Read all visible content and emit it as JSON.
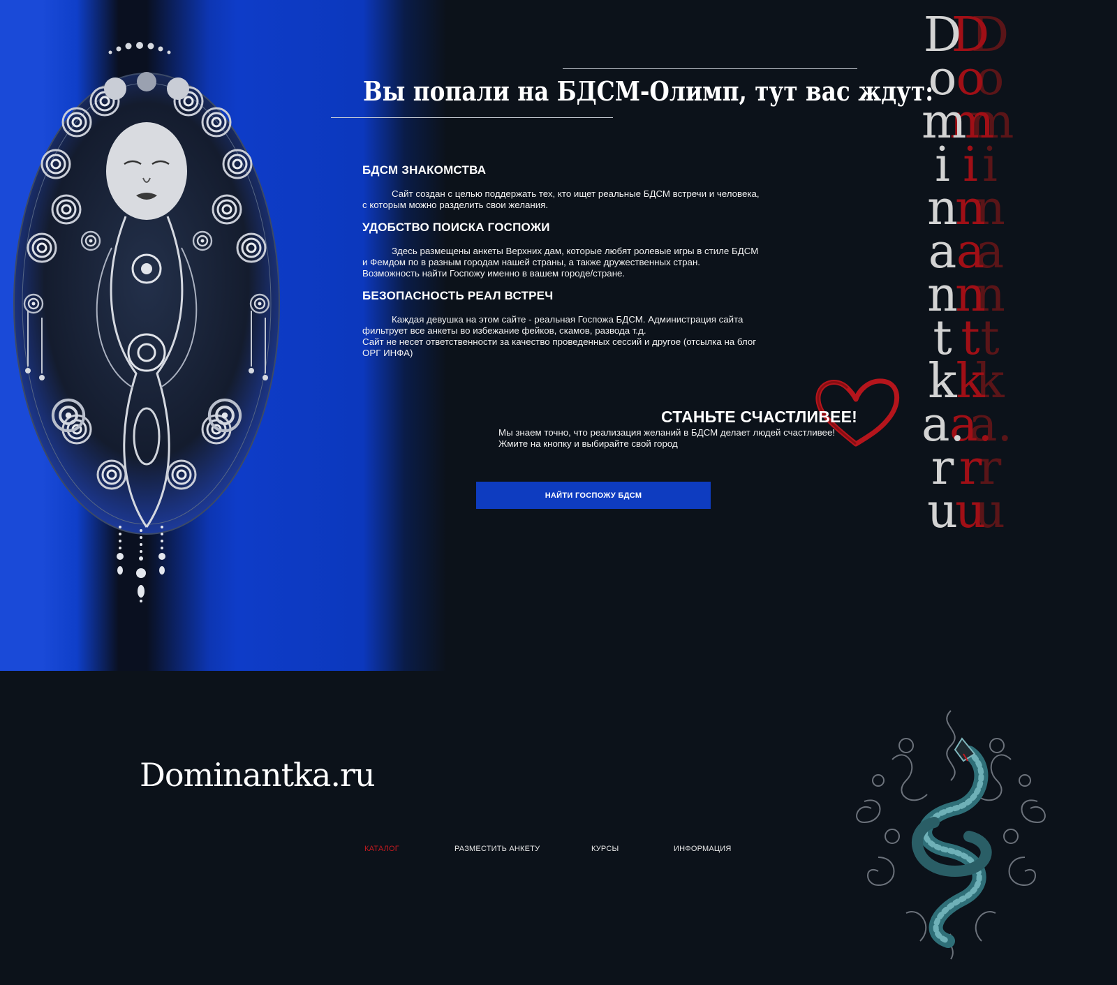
{
  "colors": {
    "background": "#0c121a",
    "accent_blue": "#0e3cc0",
    "accent_red": "#c21a20",
    "text": "#ffffff"
  },
  "hero": {
    "headline": "Вы попали на БДСМ-Олимп, тут вас ждут:",
    "features": [
      {
        "title": "БДСМ ЗНАКОМСТВА",
        "text": "Сайт создан с целью поддержать тех, кто ищет реальные БДСМ встречи и человека, \nс которым можно разделить свои желания."
      },
      {
        "title": "УДОБСТВО ПОИСКА ГОСПОЖИ",
        "text": "Здесь размещены анкеты Верхних дам, которые любят ролевые игры в стиле БДСМ \nи Фемдом по в разным городам нашей страны, а также дружественных стран.\nВозможность найти Госпожу именно в вашем городе/стране."
      },
      {
        "title": "БЕЗОПАСНОСТЬ РЕАЛ ВСТРЕЧ",
        "text": "Каждая девушка на этом сайте - реальная Госпожа БДСМ. Администрация сайта \nфильтрует все анкеты во избежание фейков, скамов, развода т.д.\nСайт не несет ответственности за качество проведенных сессий и другое (отсылка на блог \nОРГ ИНФА)"
      }
    ]
  },
  "cta": {
    "title": "СТАНЬТЕ СЧАСТЛИВЕЕ!",
    "text": "Мы знаем точно, что реализация желаний в БДСМ делает людей счастливее!\nЖмите на кнопку и выбирайте свой город",
    "button_label": "НАЙТИ ГОСПОЖУ БДСМ"
  },
  "wordmark": {
    "letters": [
      "D",
      "o",
      "m",
      "i",
      "n",
      "a",
      "n",
      "t",
      "k",
      "a.",
      "r",
      "u"
    ]
  },
  "footer": {
    "logo": "Dominantka.ru",
    "nav": [
      {
        "label": "КАТАЛОГ",
        "active": true
      },
      {
        "label": "РАЗМЕСТИТЬ АНКЕТУ",
        "active": false
      },
      {
        "label": "КУРСЫ",
        "active": false
      },
      {
        "label": "ИНФОРМАЦИЯ",
        "active": false
      }
    ]
  },
  "icons": {
    "hero_art": "ornamental-goddess-illustration",
    "heart": "heart-icon",
    "snake": "snake-illustration"
  }
}
